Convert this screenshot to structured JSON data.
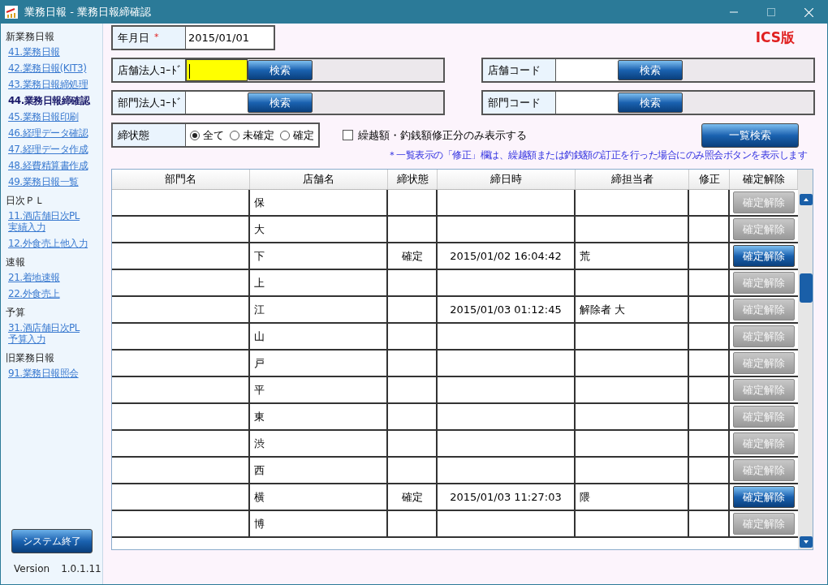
{
  "window": {
    "title": "業務日報 - 業務日報締確認"
  },
  "sidebar": {
    "groups": [
      {
        "heading": "新業務日報",
        "items": [
          {
            "label": "41.業務日報",
            "selected": false
          },
          {
            "label": "42.業務日報(KIT3)",
            "selected": false
          },
          {
            "label": "43.業務日報締処理",
            "selected": false
          },
          {
            "label": "44.業務日報締確認",
            "selected": true
          },
          {
            "label": "45.業務日報印刷",
            "selected": false
          },
          {
            "label": "46.経理データ確認",
            "selected": false
          },
          {
            "label": "47.経理データ作成",
            "selected": false
          },
          {
            "label": "48.経費精算書作成",
            "selected": false
          },
          {
            "label": "49.業務日報一覧",
            "selected": false
          }
        ]
      },
      {
        "heading": "日次ＰＬ",
        "items": [
          {
            "label": "11.酒店舗日次PL\n実績入力",
            "selected": false
          },
          {
            "label": "12.外食売上他入力",
            "selected": false
          }
        ]
      },
      {
        "heading": "速報",
        "items": [
          {
            "label": "21.着地速報",
            "selected": false
          },
          {
            "label": "22.外食売上",
            "selected": false
          }
        ]
      },
      {
        "heading": "予算",
        "items": [
          {
            "label": "31.酒店舗日次PL\n予算入力",
            "selected": false
          }
        ]
      },
      {
        "heading": "旧業務日報",
        "items": [
          {
            "label": "91.業務日報照会",
            "selected": false
          }
        ]
      }
    ],
    "exit_button": "システム終了",
    "version_label": "Version",
    "version": "1.0.1.11"
  },
  "form": {
    "date_label": "年月日",
    "required_mark": "*",
    "date_value": "2015/01/01",
    "edition": "ICS版",
    "code_fields": [
      {
        "label": "店舗法人ｺｰﾄﾞ",
        "button": "検索",
        "focused": true
      },
      {
        "label": "店舗コード",
        "button": "検索",
        "focused": false
      },
      {
        "label": "部門法人ｺｰﾄﾞ",
        "button": "検索",
        "focused": false
      },
      {
        "label": "部門コード",
        "button": "検索",
        "focused": false
      }
    ],
    "status_label": "締状態",
    "status_options": [
      {
        "label": "全て",
        "selected": true
      },
      {
        "label": "未確定",
        "selected": false
      },
      {
        "label": "確定",
        "selected": false
      }
    ],
    "filter_checkbox": {
      "label": "繰越額・釣銭額修正分のみ表示する",
      "checked": false
    },
    "list_search_button": "一覧検索",
    "note": "＊一覧表示の「修正」欄は、繰越額または釣銭額の訂正を行った場合にのみ照会ボタンを表示します"
  },
  "table": {
    "columns": [
      "部門名",
      "店舗名",
      "締状態",
      "締日時",
      "締担当者",
      "修正",
      "確定解除"
    ],
    "rows": [
      {
        "store": "保",
        "status": "",
        "closed_at": "",
        "staff": "",
        "button": "確定解除",
        "enabled": false
      },
      {
        "store": "大",
        "status": "",
        "closed_at": "",
        "staff": "",
        "button": "確定解除",
        "enabled": false
      },
      {
        "store": "下",
        "status": "確定",
        "closed_at": "2015/01/02 16:04:42",
        "staff": "荒",
        "button": "確定解除",
        "enabled": true
      },
      {
        "store": "上",
        "status": "",
        "closed_at": "",
        "staff": "",
        "button": "確定解除",
        "enabled": false
      },
      {
        "store": "江",
        "status": "",
        "closed_at": "2015/01/03 01:12:45",
        "staff": "解除者 大",
        "button": "確定解除",
        "enabled": false
      },
      {
        "store": "山",
        "status": "",
        "closed_at": "",
        "staff": "",
        "button": "確定解除",
        "enabled": false
      },
      {
        "store": "戸",
        "status": "",
        "closed_at": "",
        "staff": "",
        "button": "確定解除",
        "enabled": false
      },
      {
        "store": "平",
        "status": "",
        "closed_at": "",
        "staff": "",
        "button": "確定解除",
        "enabled": false
      },
      {
        "store": "東",
        "status": "",
        "closed_at": "",
        "staff": "",
        "button": "確定解除",
        "enabled": false
      },
      {
        "store": "渋",
        "status": "",
        "closed_at": "",
        "staff": "",
        "button": "確定解除",
        "enabled": false
      },
      {
        "store": "西",
        "status": "",
        "closed_at": "",
        "staff": "",
        "button": "確定解除",
        "enabled": false
      },
      {
        "store": "横",
        "status": "確定",
        "closed_at": "2015/01/03 11:27:03",
        "staff": "隈",
        "button": "確定解除",
        "enabled": true
      },
      {
        "store": "博",
        "status": "",
        "closed_at": "",
        "staff": "",
        "button": "確定解除",
        "enabled": false
      }
    ]
  }
}
